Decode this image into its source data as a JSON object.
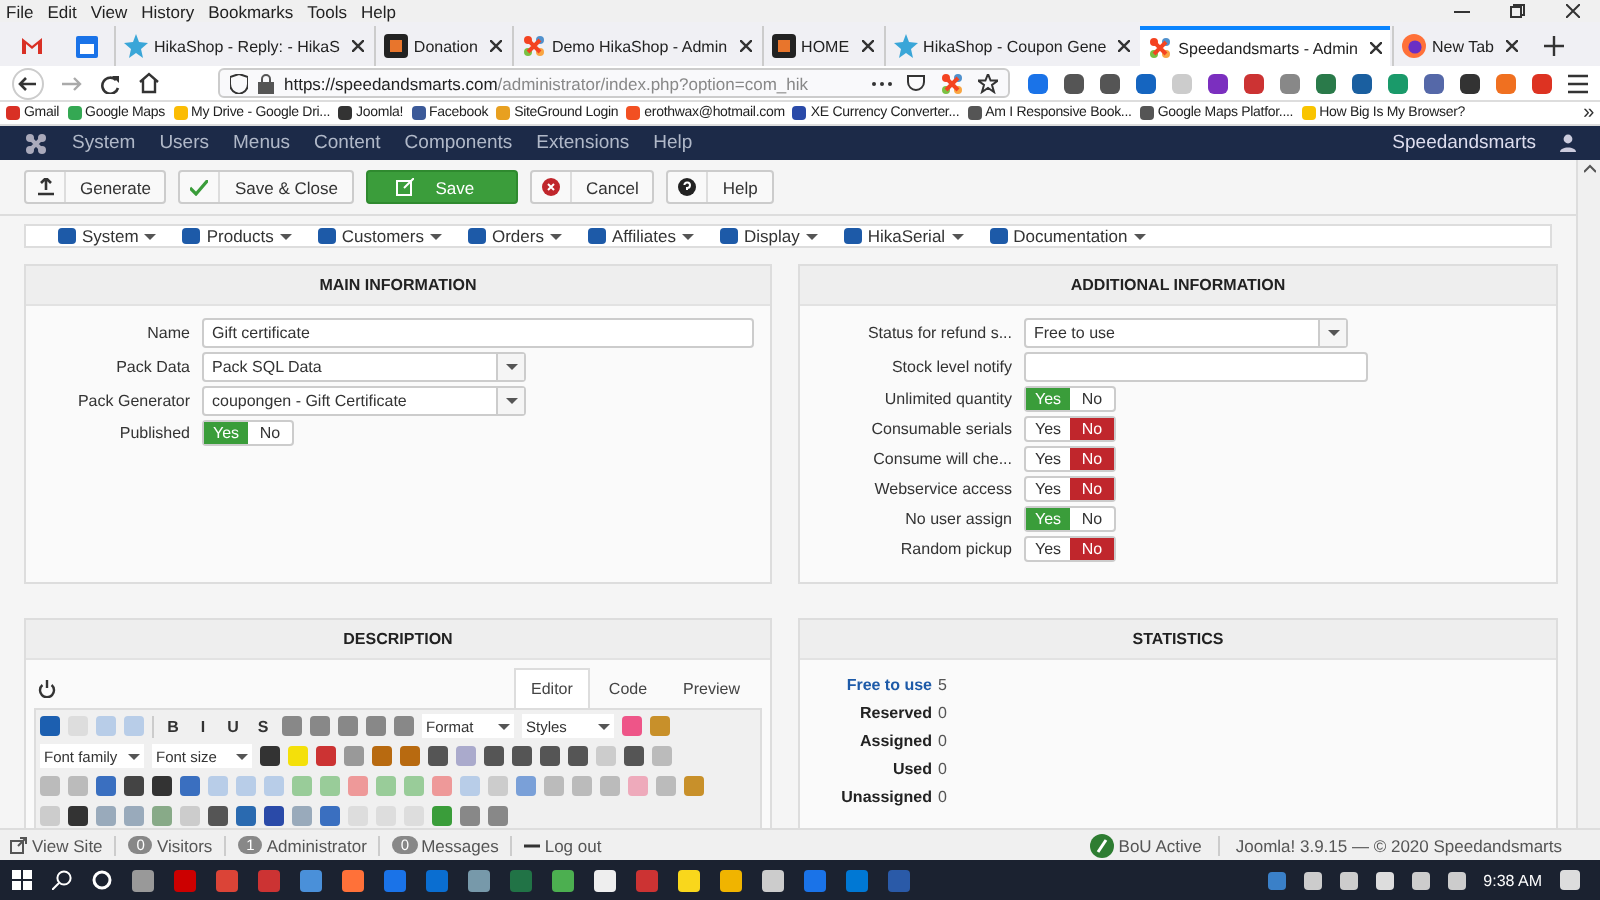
{
  "browser": {
    "menu": [
      "File",
      "Edit",
      "View",
      "History",
      "Bookmarks",
      "Tools",
      "Help"
    ],
    "tabs": [
      {
        "title": "HikaShop - Reply: - HikaS",
        "kind": "star",
        "selected": false
      },
      {
        "title": "Donation",
        "kind": "joomla",
        "selected": false
      },
      {
        "title": "Demo HikaShop - Admin",
        "kind": "joomla-color",
        "selected": false
      },
      {
        "title": "HOME",
        "kind": "joomla",
        "selected": false
      },
      {
        "title": "HikaShop - Coupon Gene",
        "kind": "star",
        "selected": false
      },
      {
        "title": "Speedandsmarts - Admin",
        "kind": "joomla-color",
        "selected": true
      },
      {
        "title": "New Tab",
        "kind": "firefox",
        "selected": false
      }
    ],
    "url": {
      "host": "https://speedandsmarts.com",
      "path": "/administrator/index.php?option=com_hik"
    },
    "bookmarks": [
      "Gmail",
      "Google Maps",
      "My Drive - Google Dri...",
      "Joomla!",
      "Facebook",
      "SiteGround Login",
      "erothwax@hotmail.com",
      "XE Currency Converter...",
      "Am I Responsive Book...",
      "Google Maps Platfor....",
      "How Big Is My Browser?"
    ],
    "bookmarks_overflow": "»"
  },
  "nav": {
    "items": [
      "System",
      "Users",
      "Menus",
      "Content",
      "Components",
      "Extensions",
      "Help"
    ],
    "site": "Speedandsmarts"
  },
  "toolbar": [
    {
      "label": "Generate",
      "kind": "upload"
    },
    {
      "label": "Save & Close",
      "kind": "check"
    },
    {
      "label": "Save",
      "kind": "primary"
    },
    {
      "label": "Cancel",
      "kind": "cancel"
    },
    {
      "label": "Help",
      "kind": "help"
    }
  ],
  "hika_menu": [
    "System",
    "Products",
    "Customers",
    "Orders",
    "Affiliates",
    "Display",
    "HikaSerial",
    "Documentation"
  ],
  "main_information": {
    "title": "MAIN INFORMATION",
    "fields": [
      {
        "label": "Name",
        "kind": "text",
        "value": "Gift certificate"
      },
      {
        "label": "Pack Data",
        "kind": "select",
        "value": "Pack SQL Data"
      },
      {
        "label": "Pack Generator",
        "kind": "select",
        "value": "coupongen - Gift Certificate"
      },
      {
        "label": "Published",
        "kind": "toggle",
        "yes": "Yes",
        "no": "No",
        "value": true
      }
    ]
  },
  "additional_information": {
    "title": "ADDITIONAL INFORMATION",
    "fields": [
      {
        "label": "Status for refund s...",
        "kind": "select",
        "value": "Free to use"
      },
      {
        "label": "Stock level notify",
        "kind": "text"
      },
      {
        "label": "Unlimited quantity",
        "kind": "toggle",
        "yes": "Yes",
        "no": "No",
        "value": true
      },
      {
        "label": "Consumable serials",
        "kind": "toggle",
        "yes": "Yes",
        "no": "No",
        "value": false
      },
      {
        "label": "Consume will che...",
        "kind": "toggle",
        "yes": "Yes",
        "no": "No",
        "value": false
      },
      {
        "label": "Webservice access",
        "kind": "toggle",
        "yes": "Yes",
        "no": "No",
        "value": false
      },
      {
        "label": "No user assign",
        "kind": "toggle",
        "yes": "Yes",
        "no": "No",
        "value": true
      },
      {
        "label": "Random pickup",
        "kind": "toggle",
        "yes": "Yes",
        "no": "No",
        "value": false
      }
    ]
  },
  "description": {
    "title": "DESCRIPTION",
    "tabs": [
      {
        "label": "Editor",
        "selected": true
      },
      {
        "label": "Code",
        "selected": false
      },
      {
        "label": "Preview",
        "selected": false
      }
    ],
    "format_buttons": [
      "B",
      "I",
      "U",
      "S"
    ],
    "selects": [
      "Format",
      "Styles",
      "Font family",
      "Font size"
    ]
  },
  "statistics": {
    "title": "STATISTICS",
    "rows": [
      {
        "label": "Free to use",
        "value": "5",
        "kind": "link"
      },
      {
        "label": "Reserved",
        "value": "0",
        "kind": "plain"
      },
      {
        "label": "Assigned",
        "value": "0",
        "kind": "plain"
      },
      {
        "label": "Used",
        "value": "0",
        "kind": "plain"
      },
      {
        "label": "Unassigned",
        "value": "0",
        "kind": "plain"
      }
    ]
  },
  "footer": {
    "view_site": "View Site",
    "counters": [
      {
        "count": "0",
        "label": "Visitors"
      },
      {
        "count": "1",
        "label": "Administrator"
      },
      {
        "count": "0",
        "label": "Messages"
      }
    ],
    "log_out": "Log out",
    "bou": "BoU Active",
    "copyright": "Joomla! 3.9.15 — © 2020 Speedandsmarts"
  },
  "taskbar": {
    "time": "9:38 AM"
  }
}
